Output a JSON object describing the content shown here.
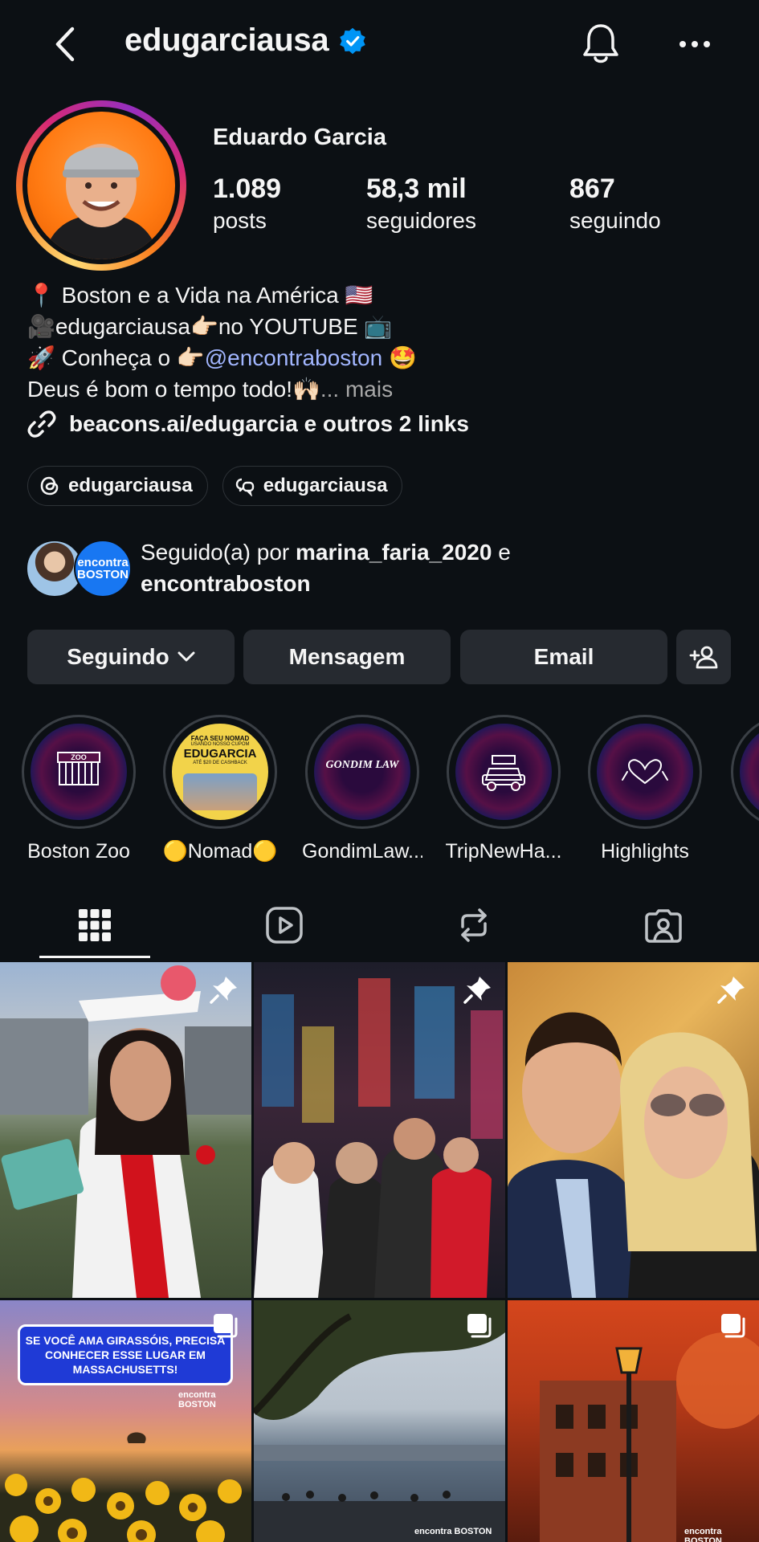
{
  "header": {
    "username": "edugarciausa",
    "back_icon": "chevron-left-icon",
    "verified_icon": "verified-badge-icon",
    "bell_icon": "bell-icon",
    "more_icon": "more-horizontal-icon"
  },
  "profile": {
    "display_name": "Eduardo Garcia",
    "stats": [
      {
        "value": "1.089",
        "label": "posts"
      },
      {
        "value": "58,3 mil",
        "label": "seguidores"
      },
      {
        "value": "867",
        "label": "seguindo"
      }
    ],
    "bio": {
      "line1": "📍 Boston e a Vida na América 🇺🇸",
      "line2": "🎥edugarciausa👉🏻no YOUTUBE 📺",
      "line3_prefix": "🚀 Conheça o 👉🏻",
      "line3_mention": "@encontraboston",
      "line3_suffix": " 🤩",
      "line4": "Deus é bom o tempo todo!🙌🏻",
      "more": "... mais"
    },
    "link_text": "beacons.ai/edugarcia e outros 2 links",
    "chips": [
      {
        "label": "edugarciausa",
        "icon": "threads-icon"
      },
      {
        "label": "edugarciausa",
        "icon": "thread-chat-icon"
      }
    ],
    "followed_by": {
      "prefix": "Seguido(a) por ",
      "user1": "marina_faria_2020",
      "connector": " e",
      "user2": "encontraboston",
      "avatar2_text": "encontra BOSTON"
    }
  },
  "actions": {
    "following": "Seguindo",
    "message": "Mensagem",
    "email": "Email",
    "add_user_icon": "add-person-icon"
  },
  "highlights": [
    {
      "label": "Boston Zoo",
      "icon": "zoo-icon"
    },
    {
      "label": "🟡Nomad🟡",
      "icon": "photo"
    },
    {
      "label": "GondimLaw...",
      "icon": "gondim-law-logo"
    },
    {
      "label": "TripNewHa...",
      "icon": "car-icon"
    },
    {
      "label": "Highlights",
      "icon": "heart-hands-icon"
    }
  ],
  "nomad_highlight_text": {
    "line1": "FAÇA SEU NOMAD",
    "line2": "USANDO NOSSO CUPOM",
    "line3": "EDUGARCIA",
    "line4": "ATÉ $20 DE CASHBACK"
  },
  "gondim_text": "GONDIM LAW",
  "tabs": [
    {
      "name": "grid",
      "icon": "grid-icon",
      "active": true
    },
    {
      "name": "reels",
      "icon": "reels-icon",
      "active": false
    },
    {
      "name": "reposts",
      "icon": "repost-icon",
      "active": false
    },
    {
      "name": "tagged",
      "icon": "tagged-user-icon",
      "active": false
    }
  ],
  "grid": {
    "posts": [
      {
        "type": "pinned",
        "icon": "pin-icon"
      },
      {
        "type": "pinned",
        "icon": "pin-icon"
      },
      {
        "type": "pinned",
        "icon": "pin-icon"
      },
      {
        "type": "carousel",
        "icon": "carousel-icon",
        "caption": "SE VOCÊ AMA GIRASSÓIS, PRECISA CONHECER ESSE LUGAR EM MASSACHUSETTS!",
        "watermark": "encontra BOSTON"
      },
      {
        "type": "carousel",
        "icon": "carousel-icon",
        "watermark": "encontra BOSTON"
      },
      {
        "type": "carousel",
        "icon": "carousel-icon",
        "watermark": "encontra BOSTON"
      }
    ]
  },
  "colors": {
    "background": "#0c1014",
    "button": "#262a30",
    "mention": "#a2b6ff",
    "verified": "#0095f6"
  }
}
